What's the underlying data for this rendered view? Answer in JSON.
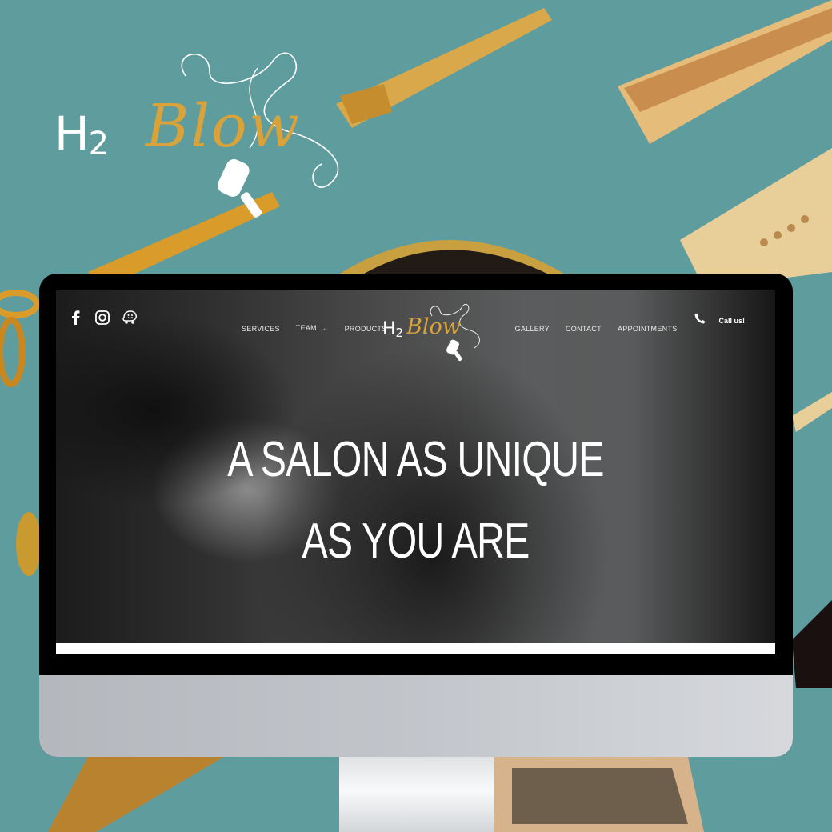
{
  "brand": {
    "h2": "H",
    "sub": "2",
    "script": "Blow",
    "accent_color": "#d9a33a",
    "background_color": "#5f9c9e"
  },
  "website": {
    "social_icons": [
      "facebook-icon",
      "instagram-icon",
      "waze-icon"
    ],
    "nav": {
      "left": [
        {
          "label": "SERVICES"
        },
        {
          "label": "TEAM",
          "has_dropdown": true
        },
        {
          "label": "PRODUCTS"
        }
      ],
      "right": [
        {
          "label": "GALLERY"
        },
        {
          "label": "CONTACT"
        },
        {
          "label": "APPOINTMENTS"
        }
      ],
      "dropdown_glyph": "⌄"
    },
    "call": {
      "icon": "phone-icon",
      "label": "Call us!"
    },
    "hero": {
      "line1": "A SALON AS UNIQUE",
      "line2": "AS YOU ARE"
    }
  }
}
